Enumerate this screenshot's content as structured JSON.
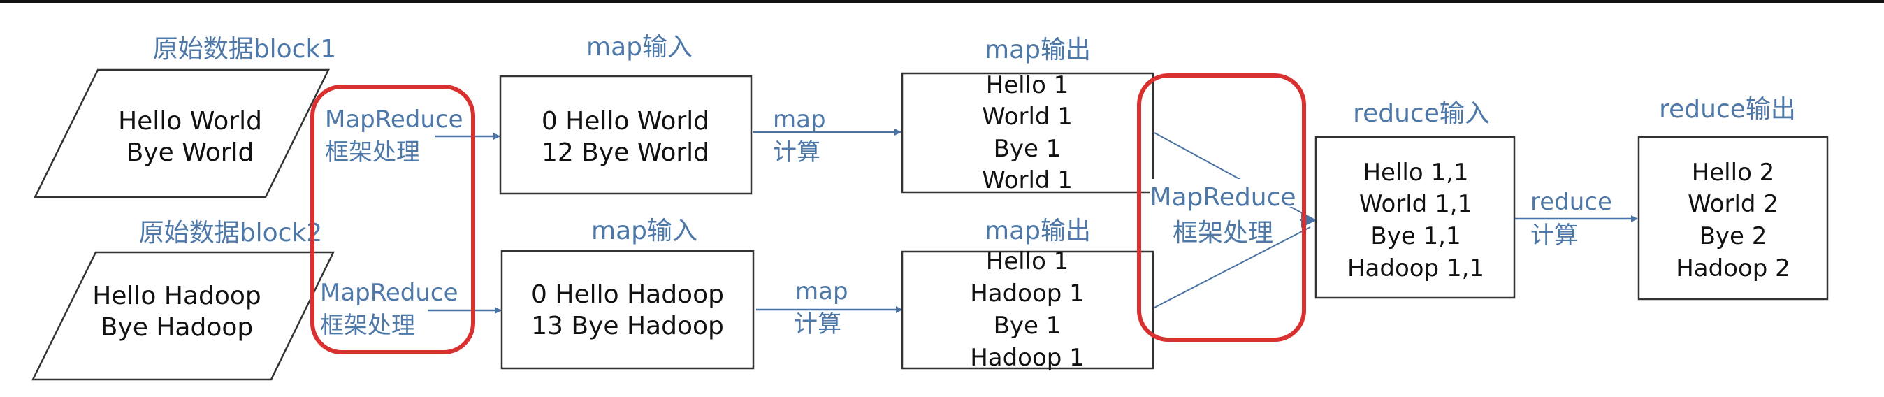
{
  "colors": {
    "label_blue": "#4e78a8",
    "arrow_blue": "#4a72a3",
    "highlight_red": "#d93030",
    "box_stroke": "#333333",
    "text": "#111111"
  },
  "block1": {
    "title": "原始数据block1",
    "lines": [
      "Hello World",
      "Bye World"
    ]
  },
  "block2": {
    "title": "原始数据block2",
    "lines": [
      "Hello Hadoop",
      "Bye Hadoop"
    ]
  },
  "framework1": {
    "line1": "MapReduce",
    "line2": "框架处理"
  },
  "framework2": {
    "line1": "MapReduce",
    "line2": "框架处理"
  },
  "map_input1": {
    "title": "map输入",
    "lines": [
      "0 Hello World",
      "12 Bye World"
    ]
  },
  "map_input2": {
    "title": "map输入",
    "lines": [
      "0 Hello Hadoop",
      "13 Bye Hadoop"
    ]
  },
  "map_calc1": {
    "line1": "map",
    "line2": "计算"
  },
  "map_calc2": {
    "line1": "map",
    "line2": "计算"
  },
  "map_output1": {
    "title": "map输出",
    "lines": [
      "Hello 1",
      "World 1",
      "Bye 1",
      "World 1"
    ]
  },
  "map_output2": {
    "title": "map输出",
    "lines": [
      "Hello 1",
      "Hadoop 1",
      "Bye 1",
      "Hadoop 1"
    ]
  },
  "framework3": {
    "line1": "MapReduce",
    "line2": "框架处理"
  },
  "reduce_input": {
    "title": "reduce输入",
    "lines": [
      "Hello 1,1",
      "World 1,1",
      "Bye 1,1",
      "Hadoop 1,1"
    ]
  },
  "reduce_calc": {
    "line1": "reduce",
    "line2": "计算"
  },
  "reduce_output": {
    "title": "reduce输出",
    "lines": [
      "Hello 2",
      "World 2",
      "Bye 2",
      "Hadoop 2"
    ]
  }
}
